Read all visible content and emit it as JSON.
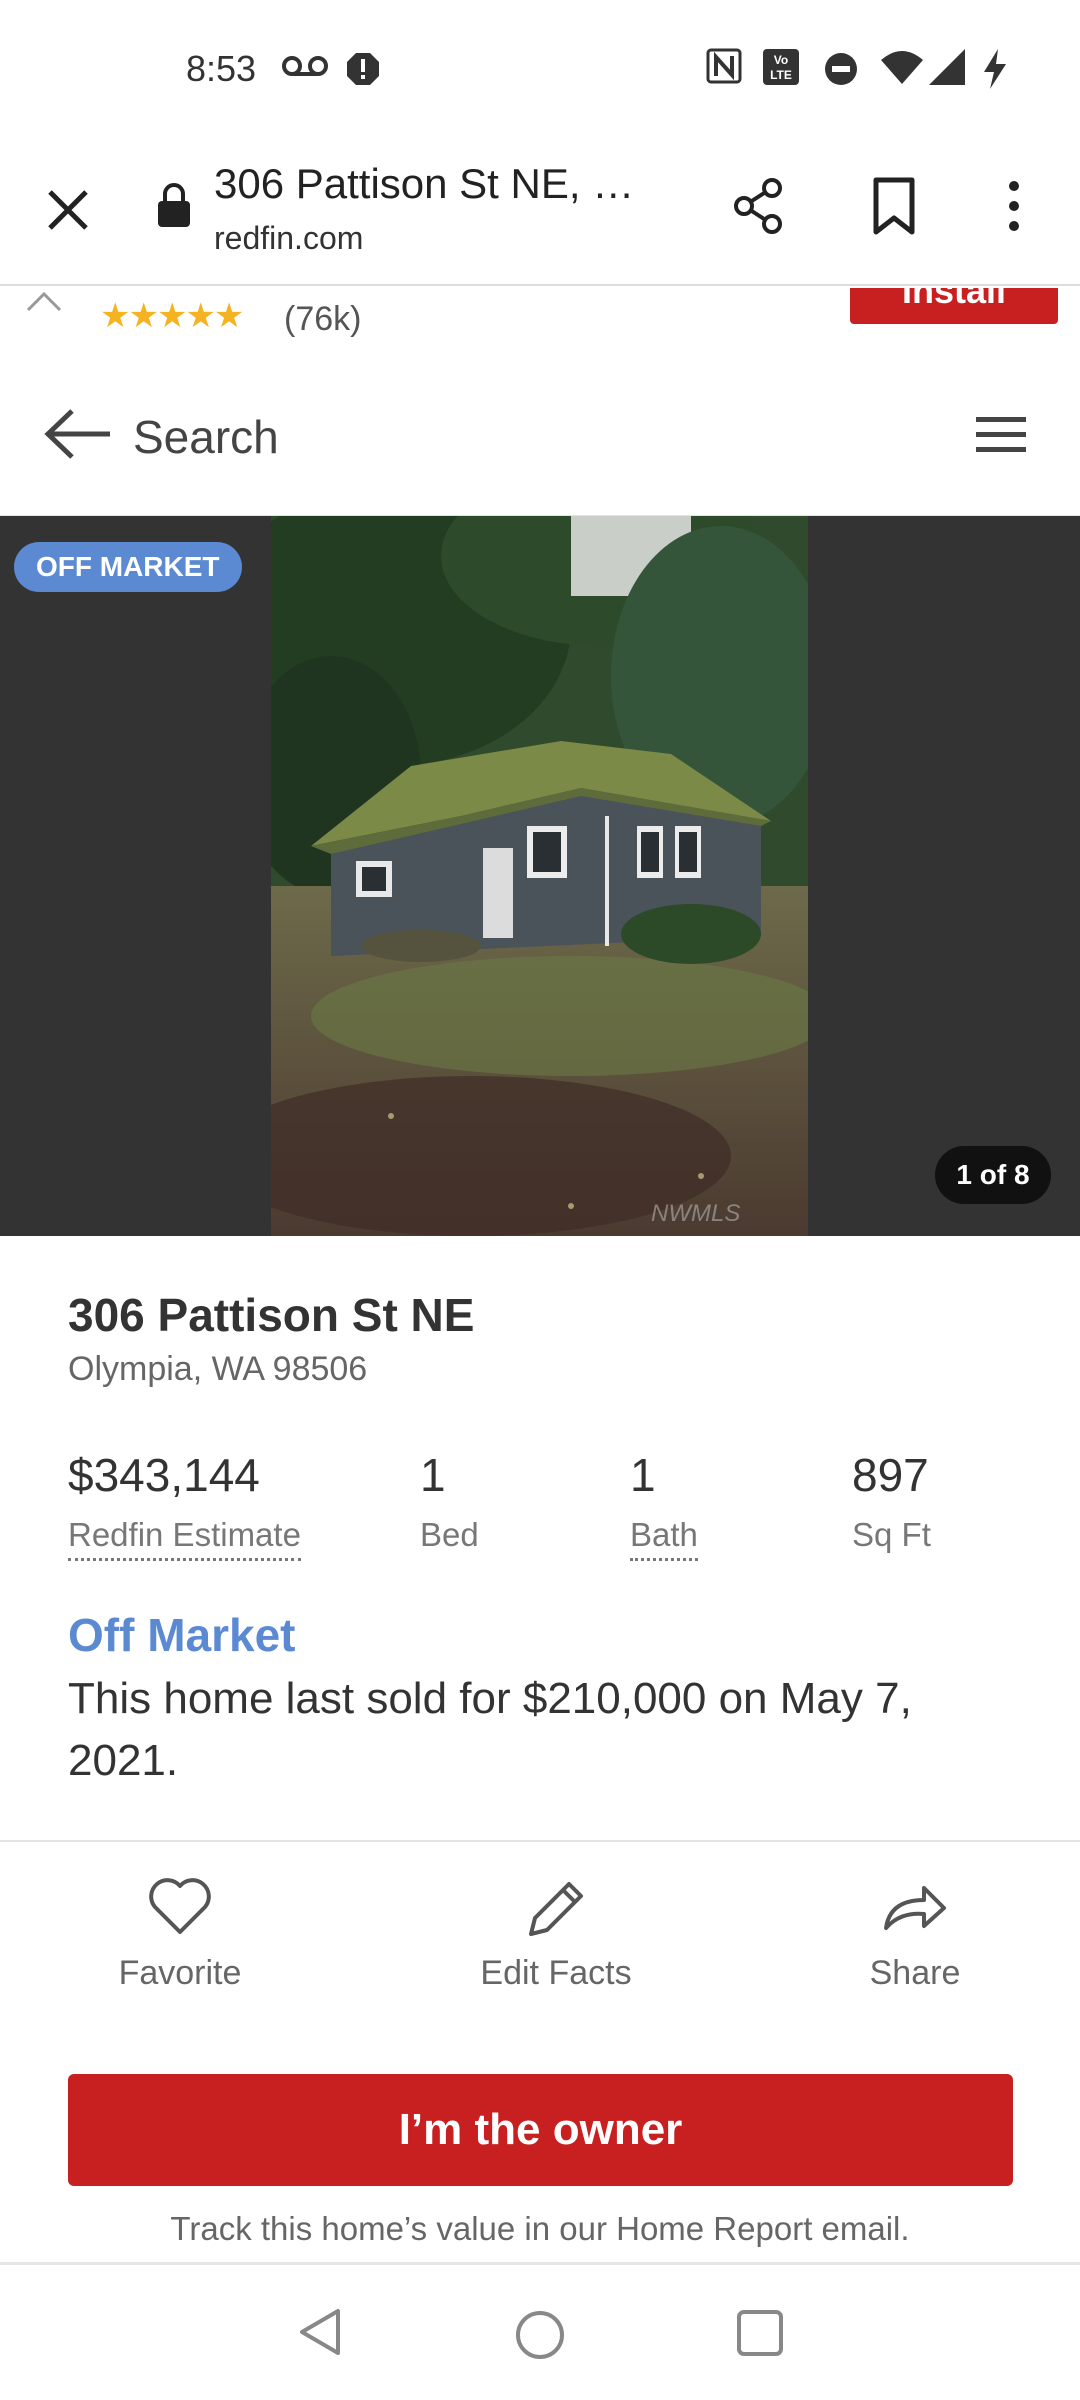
{
  "status_bar": {
    "time": "8:53",
    "icons_left": [
      "voicemail-icon",
      "alert-icon"
    ],
    "icons_right": [
      "nfc-icon",
      "volte-icon",
      "do-not-disturb-icon",
      "wifi-icon",
      "signal-icon",
      "charging-icon"
    ]
  },
  "browser": {
    "title": "306 Pattison St NE, …",
    "domain": "redfin.com"
  },
  "app_banner": {
    "stars": "★★★★★",
    "rating_count": "(76k)",
    "install_label": "Install"
  },
  "header": {
    "search_label": "Search"
  },
  "photo": {
    "badge": "OFF MARKET",
    "counter": "1 of 8"
  },
  "listing": {
    "address": "306 Pattison St NE",
    "city_state_zip": "Olympia, WA 98506",
    "stats": [
      {
        "value": "$343,144",
        "label": "Redfin Estimate"
      },
      {
        "value": "1",
        "label": "Bed"
      },
      {
        "value": "1",
        "label": "Bath"
      },
      {
        "value": "897",
        "label": "Sq Ft"
      }
    ],
    "status_heading": "Off Market",
    "status_description": "This home last sold for $210,000 on May 7, 2021."
  },
  "actions": [
    {
      "label": "Favorite",
      "icon": "heart-icon"
    },
    {
      "label": "Edit Facts",
      "icon": "pencil-icon"
    },
    {
      "label": "Share",
      "icon": "share-arrow-icon"
    }
  ],
  "owner_button": "I’m the owner",
  "track_text": "Track this home’s value in our Home Report email.",
  "colors": {
    "brand_red": "#c82021",
    "accent_blue": "#5b8ad3"
  }
}
